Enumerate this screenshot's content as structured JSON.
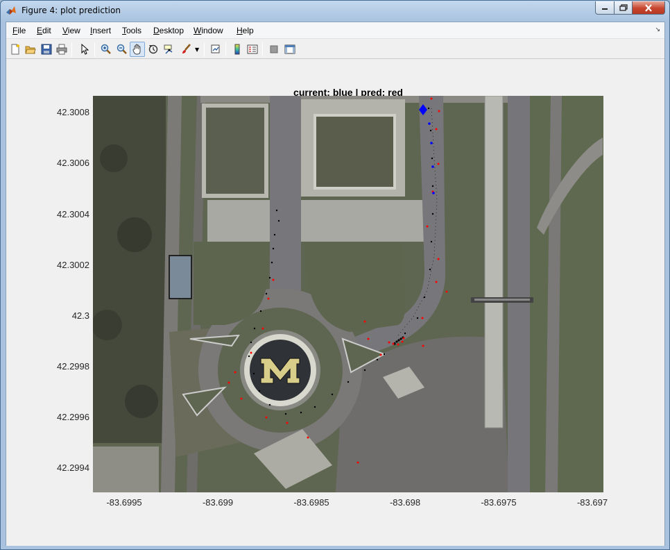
{
  "window": {
    "title": "Figure 4: plot prediction",
    "app_icon": "matlab-logo-icon",
    "controls": [
      "minimize-icon",
      "maximize-icon",
      "close-icon"
    ]
  },
  "menu": {
    "items": [
      {
        "label": "File",
        "key": "F"
      },
      {
        "label": "Edit",
        "key": "E"
      },
      {
        "label": "View",
        "key": "V"
      },
      {
        "label": "Insert",
        "key": "I"
      },
      {
        "label": "Tools",
        "key": "T"
      },
      {
        "label": "Desktop",
        "key": "D"
      },
      {
        "label": "Window",
        "key": "W"
      },
      {
        "label": "Help",
        "key": "H"
      }
    ]
  },
  "toolbar": {
    "buttons": [
      "new-figure-icon",
      "open-file-icon",
      "save-icon",
      "print-icon",
      "edit-plot-arrow-icon",
      "zoom-in-icon",
      "zoom-out-icon",
      "pan-hand-icon",
      "rotate-3d-icon",
      "data-cursor-icon",
      "brush-icon",
      "link-plot-icon",
      "colorbar-icon",
      "legend-icon",
      "hide-plot-tools-icon",
      "show-plot-tools-icon"
    ],
    "active": "pan-hand-icon"
  },
  "plot": {
    "title": "current: blue | pred: red",
    "yticks": [
      "42.3008",
      "42.3006",
      "42.3004",
      "42.3002",
      "42.3",
      "42.2998",
      "42.2996",
      "42.2994"
    ],
    "xticks": [
      "-83.6995",
      "-83.699",
      "-83.6985",
      "-83.698",
      "-83.6975",
      "-83.697"
    ],
    "background": "aerial satellite image",
    "colors": {
      "current": "#0000ff",
      "pred": "#ff0000",
      "history": "#000000"
    }
  }
}
